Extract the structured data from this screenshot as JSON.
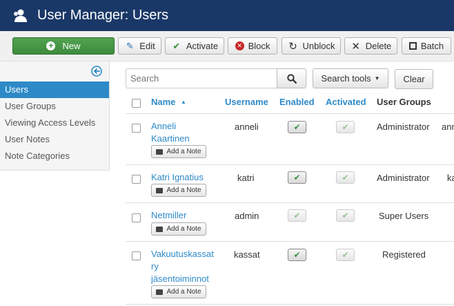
{
  "header": {
    "title": "User Manager: Users"
  },
  "toolbar": {
    "new_label": "New",
    "edit_label": "Edit",
    "activate_label": "Activate",
    "block_label": "Block",
    "unblock_label": "Unblock",
    "delete_label": "Delete",
    "batch_label": "Batch"
  },
  "sidebar": {
    "items": [
      {
        "label": "Users",
        "active": true
      },
      {
        "label": "User Groups",
        "active": false
      },
      {
        "label": "Viewing Access Levels",
        "active": false
      },
      {
        "label": "User Notes",
        "active": false
      },
      {
        "label": "Note Categories",
        "active": false
      }
    ]
  },
  "search": {
    "placeholder": "Search",
    "tools_label": "Search tools",
    "clear_label": "Clear"
  },
  "table": {
    "columns": {
      "name": "Name",
      "username": "Username",
      "enabled": "Enabled",
      "activated": "Activated",
      "groups": "User Groups"
    },
    "note_label": "Add a Note",
    "rows": [
      {
        "name_line1": "Anneli",
        "name_line2": "Kaartinen",
        "name_line3": "",
        "username": "anneli",
        "enabled": true,
        "activated": true,
        "groups": "Administrator",
        "extra": "ann"
      },
      {
        "name_line1": "Katri Ignatius",
        "name_line2": "",
        "name_line3": "",
        "username": "katri",
        "enabled": true,
        "activated": true,
        "groups": "Administrator",
        "extra": "ka"
      },
      {
        "name_line1": "Netmiller",
        "name_line2": "",
        "name_line3": "",
        "username": "admin",
        "enabled": true,
        "activated": true,
        "groups": "Super Users",
        "extra": ""
      },
      {
        "name_line1": "Vakuutuskassat",
        "name_line2": "ry",
        "name_line3": "jäsentoiminnot",
        "username": "kassat",
        "enabled": true,
        "activated": true,
        "groups": "Registered",
        "extra": ""
      }
    ]
  },
  "colors": {
    "header_bg": "#1a3867",
    "link": "#2d8ac7",
    "new_button": "#46a046",
    "check_green": "#3c8d3c"
  }
}
